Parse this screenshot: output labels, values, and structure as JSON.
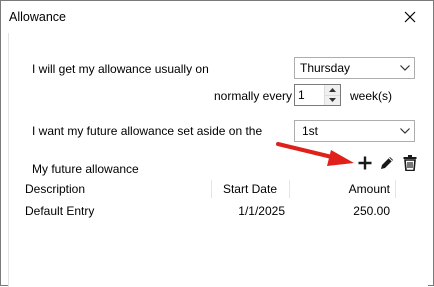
{
  "window": {
    "title": "Allowance"
  },
  "form": {
    "usual_day_label": "I will get my allowance usually on",
    "usual_day_value": "Thursday",
    "frequency_label": "normally every",
    "frequency_value": "1",
    "frequency_unit": "week(s)",
    "set_aside_label": "I want my future allowance set aside on the",
    "set_aside_value": "1st"
  },
  "future": {
    "section_label": "My future allowance",
    "columns": [
      "Description",
      "Start Date",
      "Amount"
    ],
    "rows": [
      {
        "description": "Default Entry",
        "start_date": "1/1/2025",
        "amount": "250.00"
      }
    ]
  },
  "icons": {
    "add": "plus-icon",
    "edit": "pencil-icon",
    "delete": "trash-icon",
    "annotation": "red-arrow-icon"
  },
  "colors": {
    "annotation_arrow": "#e0201b",
    "border": "#adadad"
  }
}
